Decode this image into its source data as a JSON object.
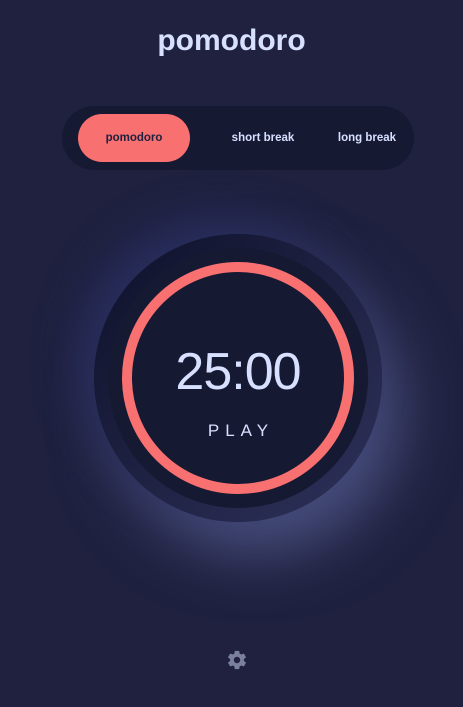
{
  "app": {
    "title": "pomodoro"
  },
  "modes": {
    "items": [
      {
        "label": "pomodoro",
        "active": true
      },
      {
        "label": "short break",
        "active": false
      },
      {
        "label": "long break",
        "active": false
      }
    ]
  },
  "timer": {
    "time": "25:00",
    "action_label": "PLAY",
    "progress": 1.0
  },
  "settings": {
    "icon": "gear-icon"
  },
  "colors": {
    "background": "#1f213f",
    "accent": "#f87070",
    "text": "#d7e0ff",
    "panel": "#161932"
  }
}
